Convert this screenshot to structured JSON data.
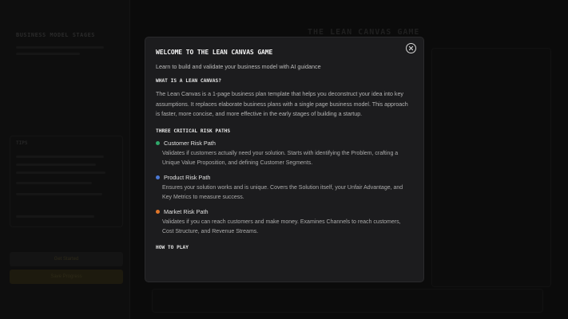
{
  "background": {
    "sidebar_title": "BUSINESS MODEL STAGES",
    "box_title": "TIPS",
    "button_1": "Get Started",
    "button_2": "Save Progress",
    "main_title": "THE LEAN CANVAS GAME"
  },
  "modal": {
    "title": "Welcome to the Lean Canvas Game",
    "subtitle": "Learn to build and validate your business model with AI guidance",
    "section_what": "What is a Lean Canvas?",
    "what_text": "The Lean Canvas is a 1-page business plan template that helps you deconstruct your idea into key assumptions. It replaces elaborate business plans with a single page business model. This approach is faster, more concise, and more effective in the early stages of building a startup.",
    "section_risk": "Three Critical Risk Paths",
    "risks": [
      {
        "name": "Customer Risk Path",
        "color": "#2fa86a",
        "desc": "Validates if customers actually need your solution. Starts with identifying the Problem, crafting a Unique Value Proposition, and defining Customer Segments."
      },
      {
        "name": "Product Risk Path",
        "color": "#4a78d4",
        "desc": "Ensures your solution works and is unique. Covers the Solution itself, your Unfair Advantage, and Key Metrics to measure success."
      },
      {
        "name": "Market Risk Path",
        "color": "#e0762a",
        "desc": "Validates if you can reach customers and make money. Examines Channels to reach customers, Cost Structure, and Revenue Streams."
      }
    ],
    "section_how": "How to Play",
    "close_icon": "close-icon"
  }
}
